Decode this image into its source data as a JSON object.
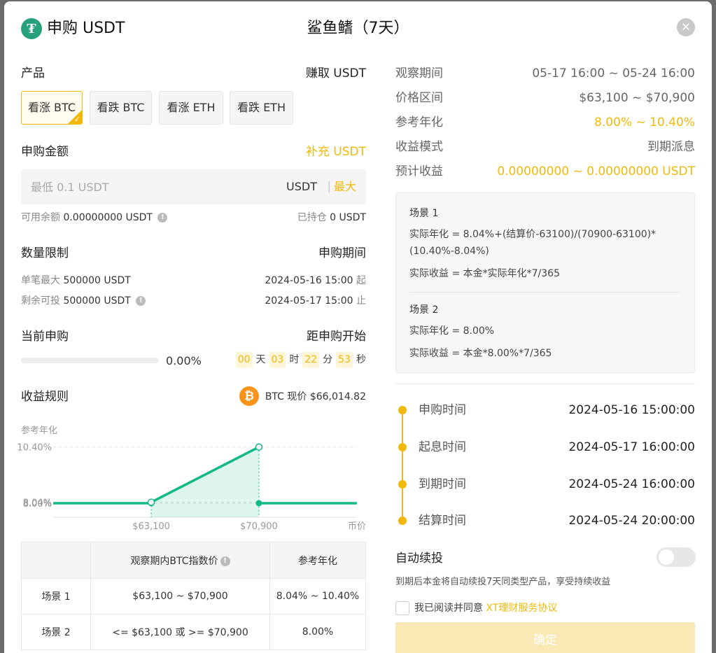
{
  "header": {
    "title": "申购 USDT",
    "product_name": "鲨鱼鳍（7天）",
    "close_glyph": "✕"
  },
  "left": {
    "product_label": "产品",
    "earn_label": "赚取 USDT",
    "products": [
      "看涨 BTC",
      "看跌 BTC",
      "看涨 ETH",
      "看跌 ETH"
    ],
    "selected_product": "看涨 BTC",
    "amount_label": "申购金额",
    "topup_link": "补充 USDT",
    "input": {
      "placeholder": "最低 0.1 USDT",
      "unit": "USDT",
      "sep": "|",
      "max_label": "最大"
    },
    "available_label": "可用余额",
    "available_value": "0.00000000 USDT",
    "held_label": "已持仓",
    "held_value": "0 USDT",
    "limit_label": "数量限制",
    "period_label": "申购期间",
    "single_max_label": "单笔最大",
    "single_max_value": "500000 USDT",
    "remaining_label": "剩余可投",
    "remaining_value": "500000 USDT",
    "period_start": "2024-05-16 15:00",
    "period_start_suffix": "起",
    "period_end": "2024-05-17 15:00",
    "period_end_suffix": "止",
    "current_label": "当前申购",
    "current_percent_text": "0.00%",
    "current_progress": 0.0,
    "countdown_label": "距申购开始",
    "countdown": {
      "d": "00",
      "d_unit": "天",
      "h": "03",
      "h_unit": "时",
      "m": "22",
      "m_unit": "分",
      "s": "53",
      "s_unit": "秒"
    },
    "rules_label": "收益规则",
    "btc_glyph": "₿",
    "btc_price_label": "BTC 现价",
    "btc_price": "$66,014.82"
  },
  "chart_data": {
    "type": "line",
    "ylabel": "参考年化",
    "xlabel": "币价",
    "y_ticks": [
      "10.40%",
      "8.04%",
      "8.00%"
    ],
    "x_ticks": [
      "$63,100",
      "$70,900"
    ],
    "ylim": [
      7.4,
      10.75
    ],
    "xlim": [
      56000,
      78000
    ],
    "series": [
      {
        "points": [
          [
            56000,
            8.0
          ],
          [
            63100,
            8.0
          ]
        ]
      },
      {
        "points": [
          [
            63100,
            8.04
          ],
          [
            70900,
            10.4
          ]
        ]
      },
      {
        "points": [
          [
            70900,
            8.0
          ],
          [
            78000,
            8.0
          ]
        ]
      }
    ],
    "color": "#12b886"
  },
  "table": {
    "headers": [
      "",
      "观察期内BTC指数价",
      "参考年化"
    ],
    "rows": [
      [
        "场景 1",
        "$63,100 ~ $70,900",
        "8.04% ~ 10.40%"
      ],
      [
        "场景 2",
        "<= $63,100 或 >= $70,900",
        "8.00%"
      ]
    ]
  },
  "right": {
    "info": [
      {
        "label": "观察期间",
        "value": "05-17 16:00 ~ 05-24 16:00"
      },
      {
        "label": "价格区间",
        "value": "$63,100 ~ $70,900"
      },
      {
        "label": "参考年化",
        "value": "8.00% ~ 10.40%"
      },
      {
        "label": "收益模式",
        "value": "到期派息"
      },
      {
        "label": "预计收益",
        "value": "0.00000000 ~ 0.00000000 USDT"
      }
    ],
    "scenario1": {
      "title": "场景 1",
      "formula1": "实际年化 = 8.04%+(结算价-63100)/(70900-63100)*(10.40%-8.04%)",
      "formula2": "实际收益 = 本金*实际年化*7/365"
    },
    "scenario2": {
      "title": "场景 2",
      "formula1": "实际年化 = 8.00%",
      "formula2": "实际收益 = 本金*8.00%*7/365"
    },
    "timeline": [
      {
        "label": "申购时间",
        "value": "2024-05-16 15:00:00"
      },
      {
        "label": "起息时间",
        "value": "2024-05-17 16:00:00"
      },
      {
        "label": "到期时间",
        "value": "2024-05-24 16:00:00"
      },
      {
        "label": "结算时间",
        "value": "2024-05-24 20:00:00"
      }
    ],
    "auto_label": "自动续投",
    "auto_desc": "到期后本金将自动续投7天同类型产品，享受持续收益",
    "agree_text": "我已阅读并同意",
    "agree_link": "XT理财服务协议",
    "confirm": "确定"
  }
}
